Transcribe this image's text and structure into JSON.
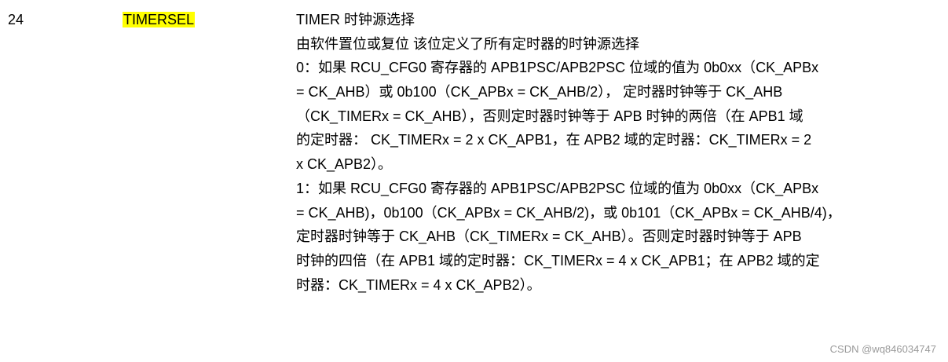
{
  "row": {
    "bit": "24",
    "field_name": "TIMERSEL",
    "field_highlight_color": "#ffff00",
    "description_lines": [
      "TIMER 时钟源选择",
      "由软件置位或复位  该位定义了所有定时器的时钟源选择",
      "0：如果 RCU_CFG0 寄存器的 APB1PSC/APB2PSC 位域的值为 0b0xx（CK_APBx",
      "= CK_AHB）或  0b100（CK_APBx = CK_AHB/2），  定时器时钟等于  CK_AHB",
      "（CK_TIMERx = CK_AHB），否则定时器时钟等于 APB 时钟的两倍（在 APB1 域",
      "的定时器：  CK_TIMERx = 2 x CK_APB1，在 APB2 域的定时器：CK_TIMERx = 2",
      "x CK_APB2）。",
      "1：如果 RCU_CFG0 寄存器的 APB1PSC/APB2PSC 位域的值为 0b0xx（CK_APBx",
      "= CK_AHB)，0b100（CK_APBx = CK_AHB/2)，或 0b101（CK_APBx = CK_AHB/4)，",
      "定时器时钟等于 CK_AHB（CK_TIMERx = CK_AHB）。否则定时器时钟等于 APB",
      "时钟的四倍（在 APB1 域的定时器：CK_TIMERx = 4 x CK_APB1；在 APB2 域的定",
      "时器：CK_TIMERx = 4 x CK_APB2）。"
    ]
  },
  "watermark": "CSDN @wq846034747"
}
